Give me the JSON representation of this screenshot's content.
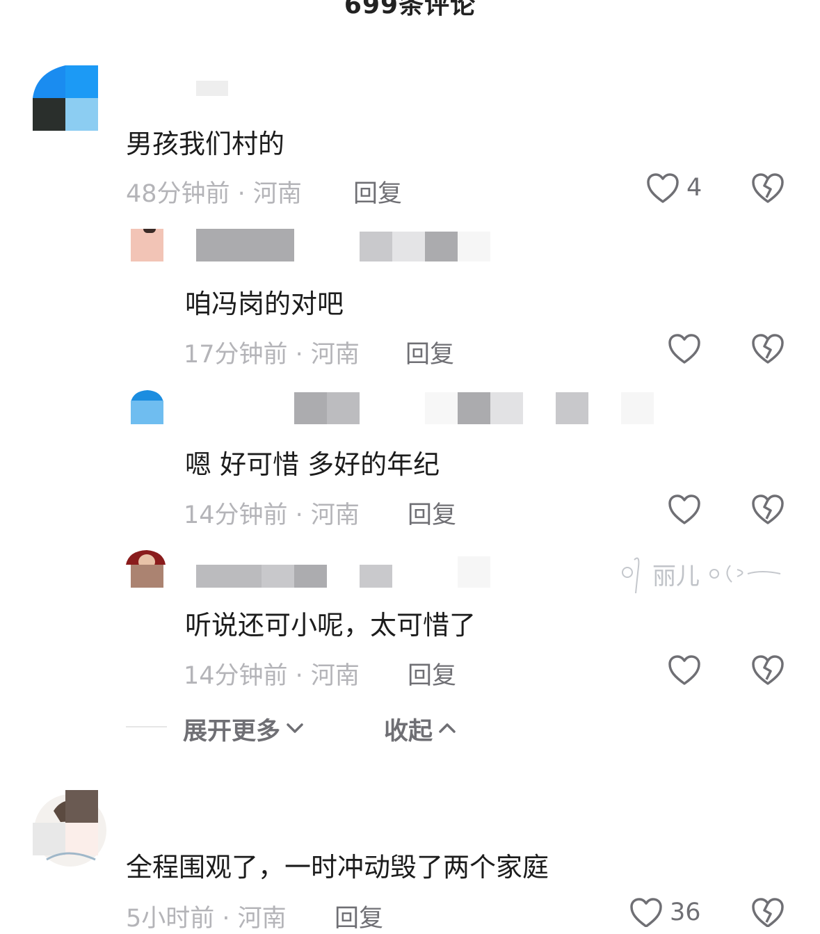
{
  "header": {
    "comment_count_title": "699条评论"
  },
  "comments": [
    {
      "text": "男孩我们村的",
      "time_location": "48分钟前 · 河南",
      "reply_label": "回复",
      "like_count": "4",
      "replies": [
        {
          "text": "咱冯岗的对吧",
          "time_location": "17分钟前 · 河南",
          "reply_label": "回复"
        },
        {
          "text": "嗯 好可惜 多好的年纪",
          "time_location": "14分钟前 · 河南",
          "reply_label": "回复"
        },
        {
          "text": "听说还可小呢，太可惜了",
          "time_location": "14分钟前 · 河南",
          "reply_label": "回复"
        }
      ],
      "expand_label": "展开更多",
      "collapse_label": "收起"
    },
    {
      "text": "全程围观了，一时冲动毁了两个家庭",
      "time_location": "5小时前 · 河南",
      "reply_label": "回复",
      "like_count": "36"
    }
  ],
  "watermark": {
    "text": "丽儿"
  },
  "icons": {
    "like": "heart-outline-icon",
    "dislike": "broken-heart-icon",
    "expand": "chevron-down-icon",
    "collapse": "chevron-up-icon"
  }
}
